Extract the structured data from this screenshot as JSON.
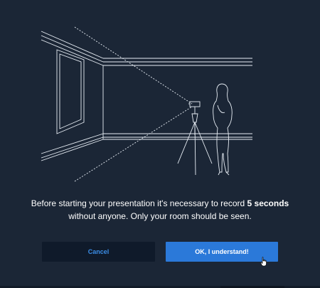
{
  "message": {
    "before": "Before starting your presentation it's necessary to record ",
    "emphasis": "5 seconds",
    "after": "without anyone. Only your room should be seen."
  },
  "buttons": {
    "cancel_label": "Cancel",
    "ok_label": "OK, I understand!"
  },
  "colors": {
    "background": "#1b2636",
    "accent": "#2b79d9",
    "cancel_bg": "#0f1a2a",
    "cancel_text": "#3b8de6"
  },
  "icons": {
    "illustration": "room-camera-illustration-icon",
    "cursor": "hand-pointer-icon"
  }
}
